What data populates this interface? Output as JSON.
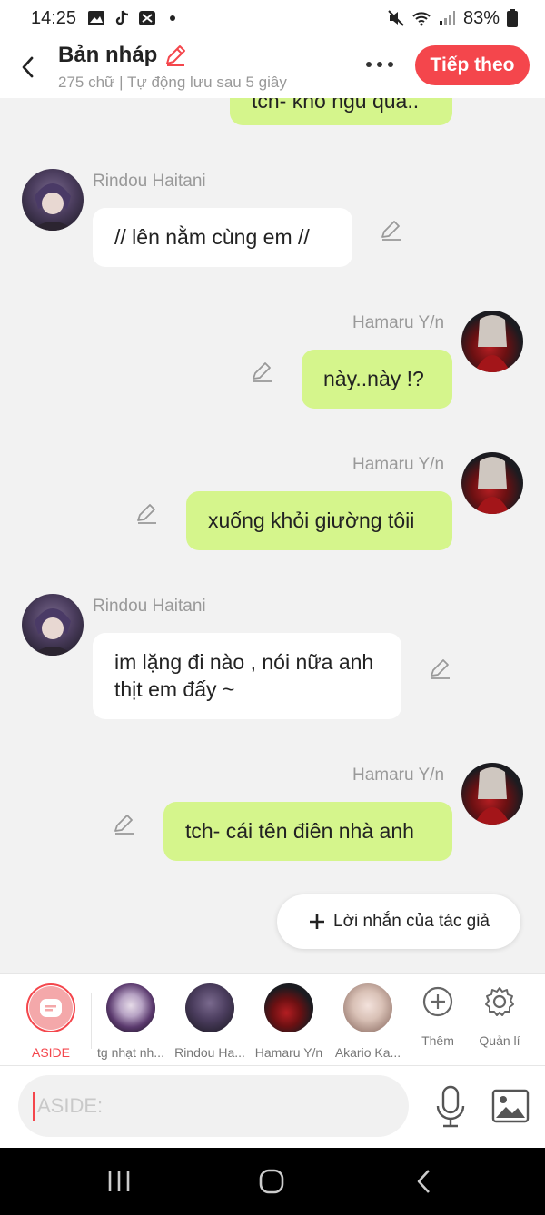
{
  "status": {
    "time": "14:25",
    "battery": "83%"
  },
  "header": {
    "title": "Bản nháp",
    "subtitle": "275 chữ | Tự động lưu sau 5 giây",
    "next_label": "Tiếp theo"
  },
  "messages": [
    {
      "speaker": "",
      "text": "tch- khó ngủ quá..",
      "side": "right"
    },
    {
      "speaker": "Rindou Haitani",
      "text": "// lên nằm cùng em //",
      "side": "left"
    },
    {
      "speaker": "Hamaru Y/n",
      "text": "này..này !?",
      "side": "right"
    },
    {
      "speaker": "Hamaru Y/n",
      "text": "xuống khỏi giường tôii",
      "side": "right"
    },
    {
      "speaker": "Rindou Haitani",
      "text": "im lặng đi nào , nói nữa anh thịt em đấy ~",
      "side": "left"
    },
    {
      "speaker": "Hamaru Y/n",
      "text": "tch- cái tên điên nhà anh",
      "side": "right"
    }
  ],
  "author_note_label": "Lời nhắn của tác giả",
  "characters": [
    {
      "label": "ASIDE"
    },
    {
      "label": "tg nhạt nh..."
    },
    {
      "label": "Rindou Ha..."
    },
    {
      "label": "Hamaru Y/n"
    },
    {
      "label": "Akario Ka..."
    },
    {
      "label": "Thêm"
    },
    {
      "label": "Quản lí"
    }
  ],
  "input": {
    "placeholder": "ASIDE:"
  },
  "colors": {
    "accent": "#f4464c",
    "right_bubble": "#d5f58c",
    "left_bubble": "#ffffff"
  }
}
